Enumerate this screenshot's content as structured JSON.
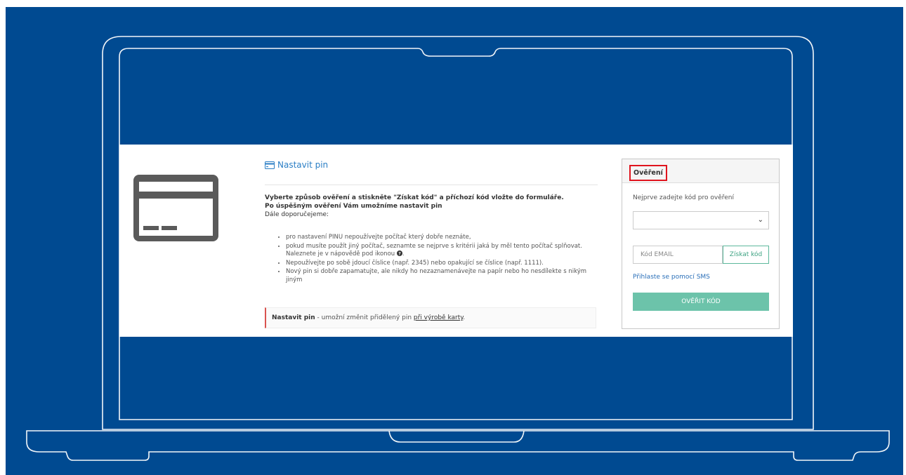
{
  "colors": {
    "background": "#004a91",
    "accent_link": "#2a7ec5",
    "highlight_border": "#e0141e",
    "verify_button": "#6cc3aa"
  },
  "icons": {
    "card": "credit-card-icon",
    "title": "credit-card-icon",
    "help": "question-circle-icon",
    "dropdown": "chevron-down-icon"
  },
  "page": {
    "title_link": "Nastavit pin",
    "instructions_bold_1": "Vyberte způsob ověření a stiskněte \"Získat kód\" a příchozí kód vložte do formuláře.",
    "instructions_bold_2": "Po úspěšným ověření Vám umožníme nastavit pin",
    "instructions_line": "Dále doporučejeme:",
    "bullets": [
      "pro nastavení PINU nepoužívejte počítač který dobře neznáte,",
      "pokud musíte použít jiný počítač, seznamte se nejprve s kritérii jaká by měl tento počítač splňovat. Naleznete je v nápovědě pod ikonou",
      "Nepoužívejte po sobě jdoucí číslice (např. 2345) nebo opakující se číslice (např. 1111).",
      "Nový pin si dobře zapamatujte, ale nikdy ho nezaznamenávejte na papír nebo ho nesdílekte s nikým jiným"
    ],
    "note_bold": "Nastavit pin",
    "note_text": " - umožní změnit přidělený pin ",
    "note_link": "při výrobě karty",
    "note_end": "."
  },
  "verification": {
    "header": "Ověření",
    "instruction": "Nejprve zadejte kód pro ověření",
    "select_value": "",
    "code_placeholder": "Kód EMAIL",
    "get_code_label": "Získat kód",
    "sms_link": "Přihlaste se pomocí SMS",
    "verify_label": "OVĚŘIT KÓD"
  }
}
